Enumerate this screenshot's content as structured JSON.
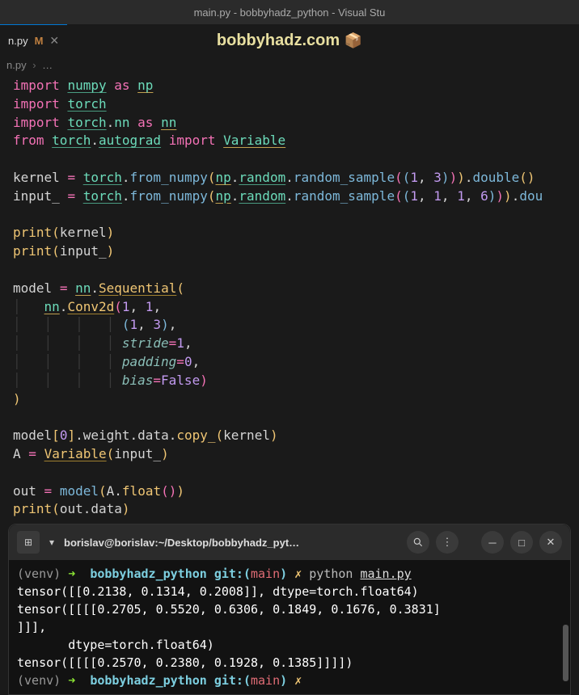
{
  "window": {
    "title": "main.py - bobbyhadz_python - Visual Stu"
  },
  "tab": {
    "filename": "n.py",
    "modified_marker": "M",
    "close_glyph": "✕"
  },
  "watermark": {
    "text": "bobbyhadz.com",
    "emoji": "📦"
  },
  "breadcrumb": {
    "file": "n.py",
    "sep": "›",
    "more": "…"
  },
  "code": {
    "l1": {
      "kw1": "import",
      "mod": "numpy",
      "as": "as",
      "alias": "np"
    },
    "l2": {
      "kw1": "import",
      "mod": "torch"
    },
    "l3": {
      "kw1": "import",
      "mod": "torch",
      "sub": "nn",
      "as": "as",
      "alias": "nn"
    },
    "l4": {
      "kw1": "from",
      "mod": "torch",
      "sub": "autograd",
      "kw2": "import",
      "cls": "Variable"
    },
    "l6": {
      "v": "kernel",
      "obj": "torch",
      "fn": "from_numpy",
      "np": "np",
      "rnd": "random",
      "rs": "random_sample",
      "a": "1",
      "b": "3",
      "dbl": "double"
    },
    "l7": {
      "v": "input_",
      "obj": "torch",
      "fn": "from_numpy",
      "np": "np",
      "rnd": "random",
      "rs": "random_sample",
      "a": "1",
      "b": "1",
      "c": "1",
      "d": "6",
      "dbl": "dou"
    },
    "l9": {
      "fn": "print",
      "v": "kernel"
    },
    "l10": {
      "fn": "print",
      "v": "input_"
    },
    "l12": {
      "v": "model",
      "nn": "nn",
      "seq": "Sequential"
    },
    "l13": {
      "nn": "nn",
      "conv": "Conv2d",
      "a": "1",
      "b": "1"
    },
    "l14": {
      "a": "1",
      "b": "3"
    },
    "l15": {
      "k": "stride",
      "v": "1"
    },
    "l16": {
      "k": "padding",
      "v": "0"
    },
    "l17": {
      "k": "bias",
      "v": "False"
    },
    "l20": {
      "v": "model",
      "idx": "0",
      "w": "weight",
      "d": "data",
      "fn": "copy_",
      "arg": "kernel"
    },
    "l21": {
      "v": "A",
      "cls": "Variable",
      "arg": "input_"
    },
    "l23": {
      "v": "out",
      "m": "model",
      "a": "A",
      "fn": "float"
    },
    "l24": {
      "fn": "print",
      "v": "out",
      "d": "data"
    }
  },
  "terminal": {
    "title": "borislav@borislav:~/Desktop/bobbyhadz_pyt…",
    "prompt1": {
      "venv": "(venv)",
      "arrow": "➜",
      "dir": "bobbyhadz_python",
      "git": "git:(",
      "branch": "main",
      "gitend": ")",
      "cross": "✗",
      "cmd": "python",
      "file": "main.py"
    },
    "out1": "tensor([[0.2138, 0.1314, 0.2008]], dtype=torch.float64)",
    "out2": "tensor([[[[0.2705, 0.5520, 0.6306, 0.1849, 0.1676, 0.3831]",
    "out3": "]]],",
    "out4": "       dtype=torch.float64)",
    "out5": "tensor([[[[0.2570, 0.2380, 0.1928, 0.1385]]]])",
    "prompt2": {
      "venv": "(venv)",
      "arrow": "➜",
      "dir": "bobbyhadz_python",
      "git": "git:(",
      "branch": "main",
      "gitend": ")",
      "cross": "✗"
    }
  }
}
